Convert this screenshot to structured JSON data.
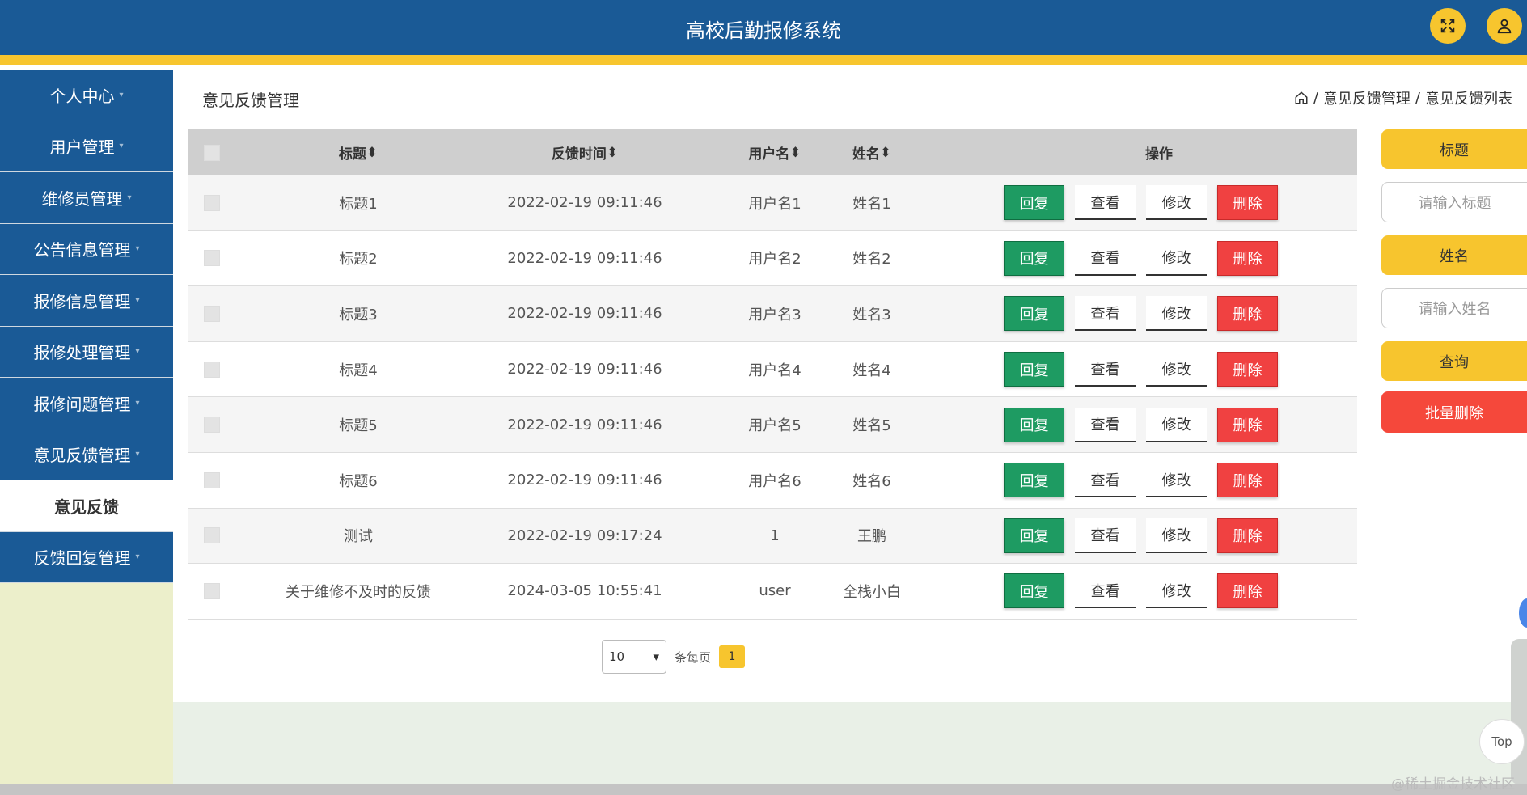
{
  "header": {
    "title": "高校后勤报修系统",
    "fullscreen_icon": "expand-icon",
    "user_icon": "user-icon"
  },
  "sidebar": {
    "items": [
      {
        "label": "个人中心",
        "active": false
      },
      {
        "label": "用户管理",
        "active": false
      },
      {
        "label": "维修员管理",
        "active": false
      },
      {
        "label": "公告信息管理",
        "active": false
      },
      {
        "label": "报修信息管理",
        "active": false
      },
      {
        "label": "报修处理管理",
        "active": false
      },
      {
        "label": "报修问题管理",
        "active": false
      },
      {
        "label": "意见反馈管理",
        "active": false
      },
      {
        "label": "意见反馈",
        "active": true
      },
      {
        "label": "反馈回复管理",
        "active": false
      }
    ]
  },
  "page": {
    "title": "意见反馈管理",
    "breadcrumb": {
      "sep": "/",
      "items": [
        "意见反馈管理",
        "意见反馈列表"
      ]
    }
  },
  "table": {
    "headers": {
      "title": "标题",
      "time": "反馈时间",
      "user": "用户名",
      "name": "姓名",
      "ops": "操作",
      "sort_icon": "⬍"
    },
    "actions": {
      "reply": "回复",
      "view": "查看",
      "edit": "修改",
      "delete": "删除"
    },
    "rows": [
      {
        "title": "标题1",
        "time": "2022-02-19 09:11:46",
        "user": "用户名1",
        "name": "姓名1"
      },
      {
        "title": "标题2",
        "time": "2022-02-19 09:11:46",
        "user": "用户名2",
        "name": "姓名2"
      },
      {
        "title": "标题3",
        "time": "2022-02-19 09:11:46",
        "user": "用户名3",
        "name": "姓名3"
      },
      {
        "title": "标题4",
        "time": "2022-02-19 09:11:46",
        "user": "用户名4",
        "name": "姓名4"
      },
      {
        "title": "标题5",
        "time": "2022-02-19 09:11:46",
        "user": "用户名5",
        "name": "姓名5"
      },
      {
        "title": "标题6",
        "time": "2022-02-19 09:11:46",
        "user": "用户名6",
        "name": "姓名6"
      },
      {
        "title": "测试",
        "time": "2022-02-19 09:17:24",
        "user": "1",
        "name": "王鹏"
      },
      {
        "title": "关于维修不及时的反馈",
        "time": "2024-03-05 10:55:41",
        "user": "user",
        "name": "全栈小白"
      }
    ]
  },
  "pagination": {
    "page_size": "10",
    "per_page_label": "条每页",
    "current_page": "1"
  },
  "search": {
    "title_label": "标题",
    "title_placeholder": "请输入标题",
    "name_label": "姓名",
    "name_placeholder": "请输入姓名",
    "query_label": "查询",
    "batch_delete_label": "批量删除"
  },
  "misc": {
    "top_label": "Top",
    "watermark": "@稀土掘金技术社区"
  },
  "colors": {
    "primary_blue": "#1a5a96",
    "accent_yellow": "#f7c52e",
    "reply_green": "#1e9b62",
    "delete_red": "#f04141"
  }
}
